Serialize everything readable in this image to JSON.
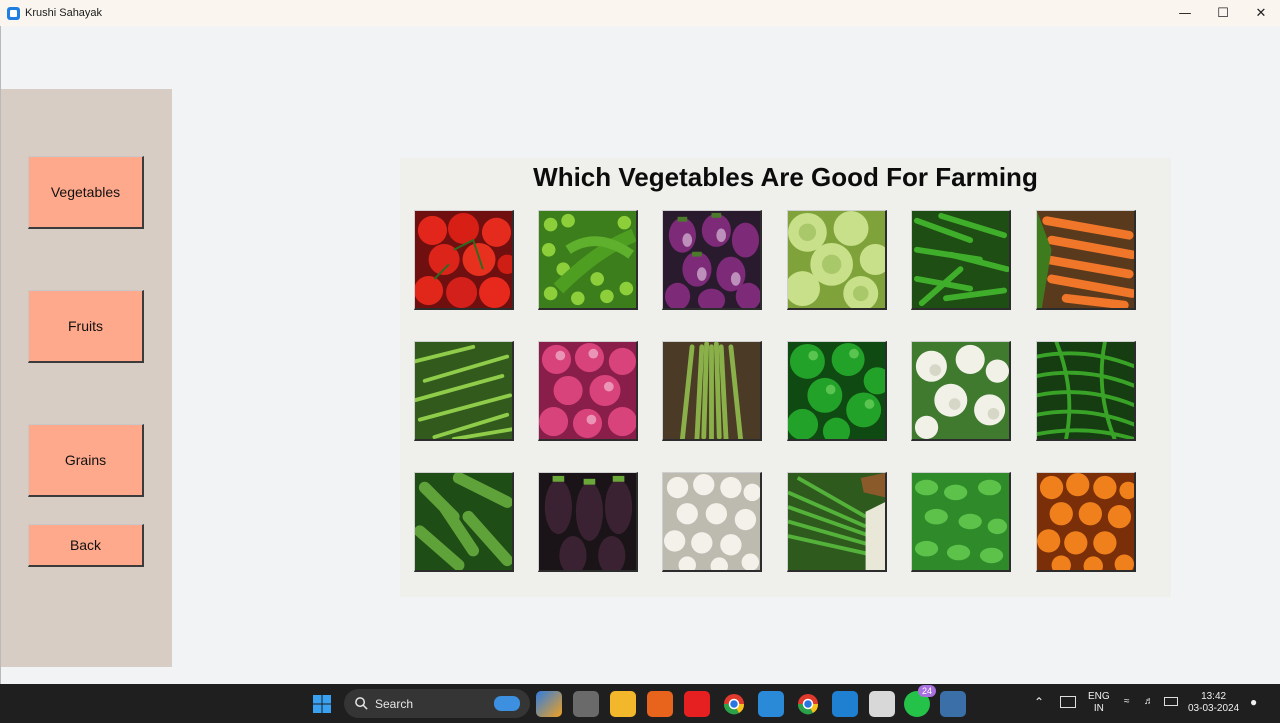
{
  "window": {
    "title": "Krushi Sahayak"
  },
  "sidebar": {
    "buttons": [
      {
        "label": "Vegetables"
      },
      {
        "label": "Fruits"
      },
      {
        "label": "Grains"
      },
      {
        "label": "Back"
      }
    ]
  },
  "main": {
    "title": "Which Vegetables Are Good For Farming",
    "images": [
      "tomato-image",
      "peas-image",
      "brinjal-image",
      "cabbage-image",
      "okra-image",
      "carrot-image",
      "green-beans-image",
      "onion-image",
      "drumstick-image",
      "capsicum-image",
      "cauliflower-image",
      "green-chilli-image",
      "cucumber-image",
      "eggplant-image",
      "garlic-image",
      "spring-onion-image",
      "mint-image",
      "pumpkin-image"
    ]
  },
  "taskbar": {
    "search_label": "Search",
    "whatsapp_badge": "24",
    "lang_top": "ENG",
    "lang_bottom": "IN",
    "time": "13:42",
    "date": "03-03-2024"
  }
}
